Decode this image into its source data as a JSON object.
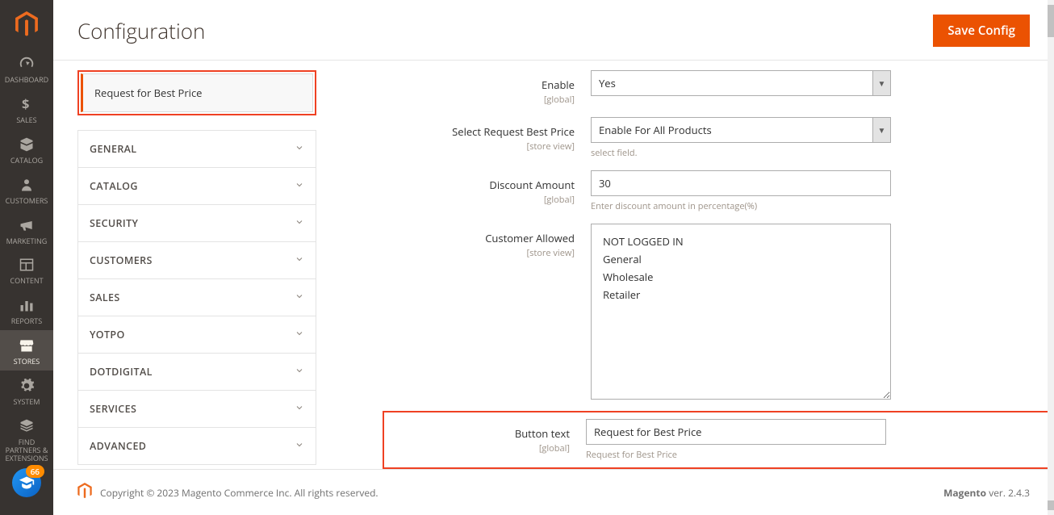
{
  "header": {
    "title": "Configuration",
    "save_label": "Save Config"
  },
  "sidebar": {
    "items": [
      {
        "id": "dashboard",
        "label": "DASHBOARD"
      },
      {
        "id": "sales",
        "label": "SALES"
      },
      {
        "id": "catalog",
        "label": "CATALOG"
      },
      {
        "id": "customers",
        "label": "CUSTOMERS"
      },
      {
        "id": "marketing",
        "label": "MARKETING"
      },
      {
        "id": "content",
        "label": "CONTENT"
      },
      {
        "id": "reports",
        "label": "REPORTS"
      },
      {
        "id": "stores",
        "label": "STORES"
      },
      {
        "id": "system",
        "label": "SYSTEM"
      },
      {
        "id": "partners",
        "label": "FIND PARTNERS & EXTENSIONS"
      }
    ],
    "grad_badge": "66"
  },
  "nav": {
    "active_tab": "Request for Best Price",
    "sections": [
      "GENERAL",
      "CATALOG",
      "SECURITY",
      "CUSTOMERS",
      "SALES",
      "YOTPO",
      "DOTDIGITAL",
      "SERVICES",
      "ADVANCED"
    ]
  },
  "form": {
    "enable": {
      "label": "Enable",
      "scope": "[global]",
      "value": "Yes"
    },
    "select_req": {
      "label": "Select Request Best Price",
      "scope": "[store view]",
      "value": "Enable For All Products",
      "hint": "select field."
    },
    "discount": {
      "label": "Discount Amount",
      "scope": "[global]",
      "value": "30",
      "hint": "Enter discount amount in percentage(%)"
    },
    "customer_allowed": {
      "label": "Customer Allowed",
      "scope": "[store view]",
      "options": [
        "NOT LOGGED IN",
        "General",
        "Wholesale",
        "Retailer"
      ]
    },
    "button_text": {
      "label": "Button text",
      "scope": "[global]",
      "value": "Request for Best Price",
      "hint": "Request for Best Price"
    }
  },
  "footer": {
    "copyright": "Copyright © 2023 Magento Commerce Inc. All rights reserved.",
    "version_label": "Magento",
    "version": " ver. 2.4.3"
  }
}
